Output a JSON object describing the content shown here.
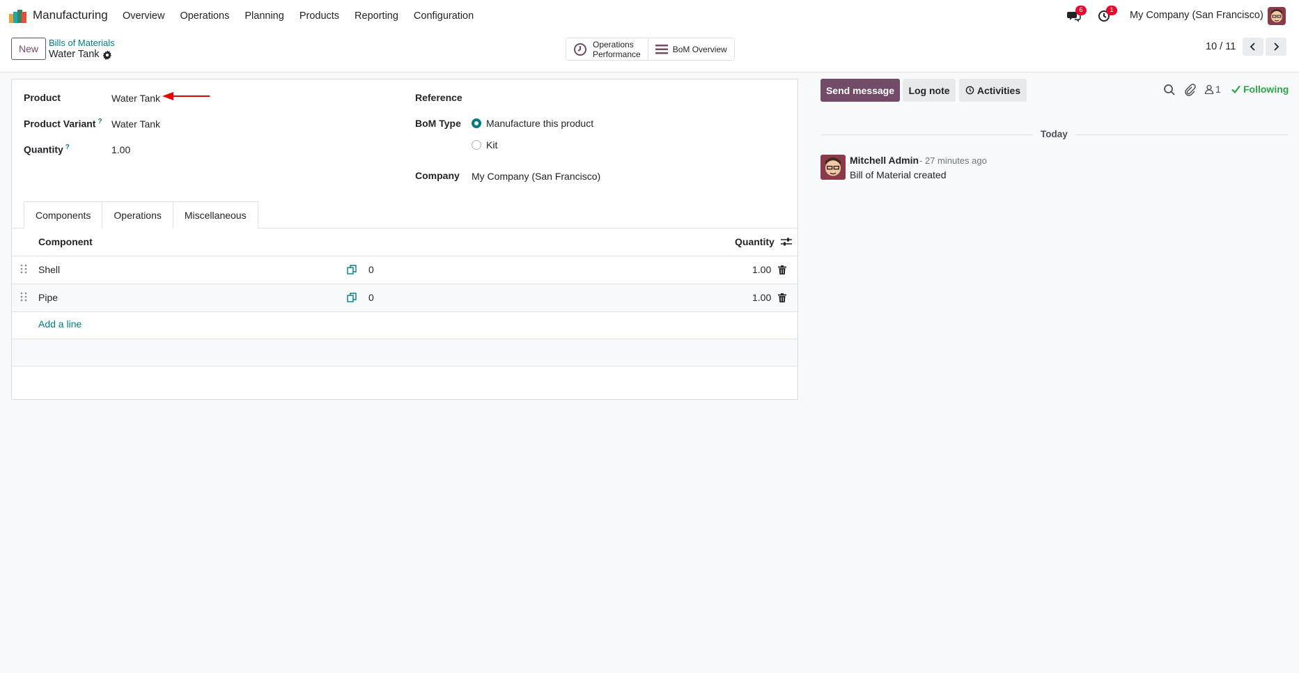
{
  "app": {
    "name": "Manufacturing",
    "menu": [
      "Overview",
      "Operations",
      "Planning",
      "Products",
      "Reporting",
      "Configuration"
    ],
    "messages_badge": "6",
    "activities_badge": "1",
    "company": "My Company (San Francisco)"
  },
  "control": {
    "new_label": "New",
    "breadcrumb_parent": "Bills of Materials",
    "breadcrumb_current": "Water Tank",
    "smart_buttons": {
      "operations_performance_line1": "Operations",
      "operations_performance_line2": "Performance",
      "bom_overview": "BoM Overview"
    },
    "pager": "10 / 11"
  },
  "form": {
    "product_label": "Product",
    "product_value": "Water Tank",
    "variant_label": "Product Variant",
    "variant_value": "Water Tank",
    "quantity_label": "Quantity",
    "quantity_value": "1.00",
    "reference_label": "Reference",
    "bom_type_label": "BoM Type",
    "bom_type_options": [
      "Manufacture this product",
      "Kit"
    ],
    "bom_type_selected": "Manufacture this product",
    "company_label": "Company",
    "company_value": "My Company (San Francisco)",
    "help_mark": "?"
  },
  "tabs": [
    "Components",
    "Operations",
    "Miscellaneous"
  ],
  "active_tab": "Components",
  "components_table": {
    "headers": {
      "component": "Component",
      "quantity": "Quantity"
    },
    "rows": [
      {
        "component": "Shell",
        "available": "0",
        "quantity": "1.00"
      },
      {
        "component": "Pipe",
        "available": "0",
        "quantity": "1.00"
      }
    ],
    "add_line": "Add a line"
  },
  "chatter": {
    "send_message": "Send message",
    "log_note": "Log note",
    "activities": "Activities",
    "followers_count": "1",
    "following": "Following",
    "date_separator": "Today",
    "message": {
      "author": "Mitchell Admin",
      "time": "- 27 minutes ago",
      "body": "Bill of Material created"
    }
  },
  "colors": {
    "brand": "#714b67",
    "accent": "#017e84",
    "badge": "#e4092d",
    "following": "#28a745",
    "annotation_arrow": "#e60000"
  }
}
